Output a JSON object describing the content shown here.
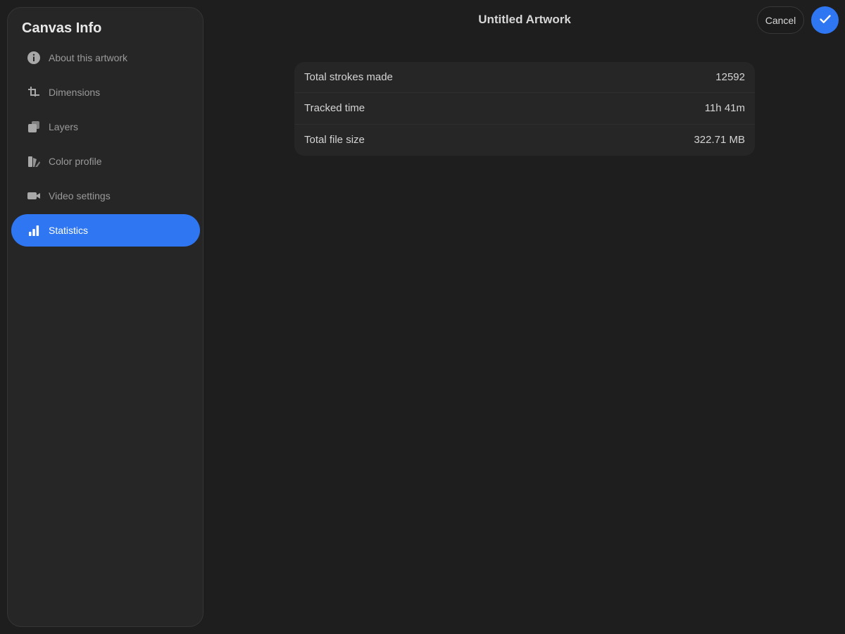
{
  "sidebar": {
    "title": "Canvas Info",
    "items": [
      {
        "label": "About this artwork",
        "icon": "info-icon",
        "active": false
      },
      {
        "label": "Dimensions",
        "icon": "crop-icon",
        "active": false
      },
      {
        "label": "Layers",
        "icon": "layers-icon",
        "active": false
      },
      {
        "label": "Color profile",
        "icon": "color-profile-icon",
        "active": false
      },
      {
        "label": "Video settings",
        "icon": "video-camera-icon",
        "active": false
      },
      {
        "label": "Statistics",
        "icon": "bar-chart-icon",
        "active": true
      }
    ]
  },
  "header": {
    "title": "Untitled Artwork",
    "cancel_label": "Cancel",
    "confirm_icon": "checkmark-icon"
  },
  "statistics": {
    "rows": [
      {
        "label": "Total strokes made",
        "value": "12592"
      },
      {
        "label": "Tracked time",
        "value": "11h 41m"
      },
      {
        "label": "Total file size",
        "value": "322.71 MB"
      }
    ]
  },
  "colors": {
    "accent": "#2f76f2",
    "background": "#1e1e1e",
    "panel": "#262626"
  }
}
